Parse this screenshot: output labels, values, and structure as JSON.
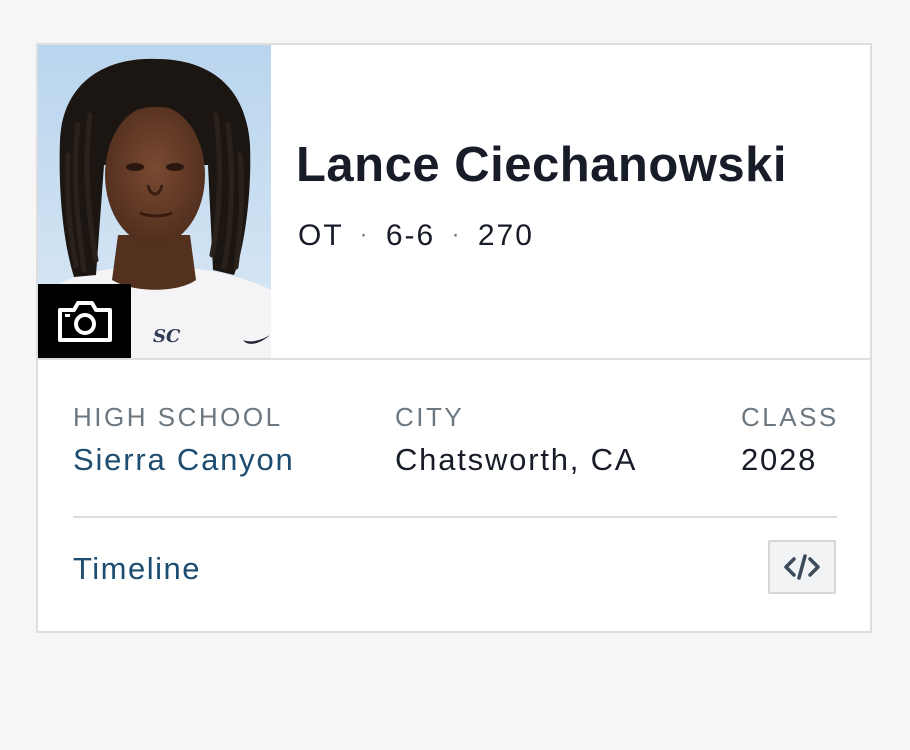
{
  "player": {
    "name": "Lance Ciechanowski",
    "position": "OT",
    "height": "6-6",
    "weight": "270",
    "separator": "·",
    "photo_icon": "camera-icon",
    "jersey_logo": "SC"
  },
  "details": {
    "high_school_label": "HIGH SCHOOL",
    "high_school_value": "Sierra Canyon",
    "city_label": "CITY",
    "city_value": "Chatsworth, CA",
    "class_label": "CLASS",
    "class_value": "2028"
  },
  "footer": {
    "timeline_label": "Timeline",
    "embed_icon": "code-embed-icon"
  },
  "colors": {
    "text_dark": "#171c28",
    "label_gray": "#6c7780",
    "link_blue": "#1d4d70",
    "border": "#dedede"
  }
}
